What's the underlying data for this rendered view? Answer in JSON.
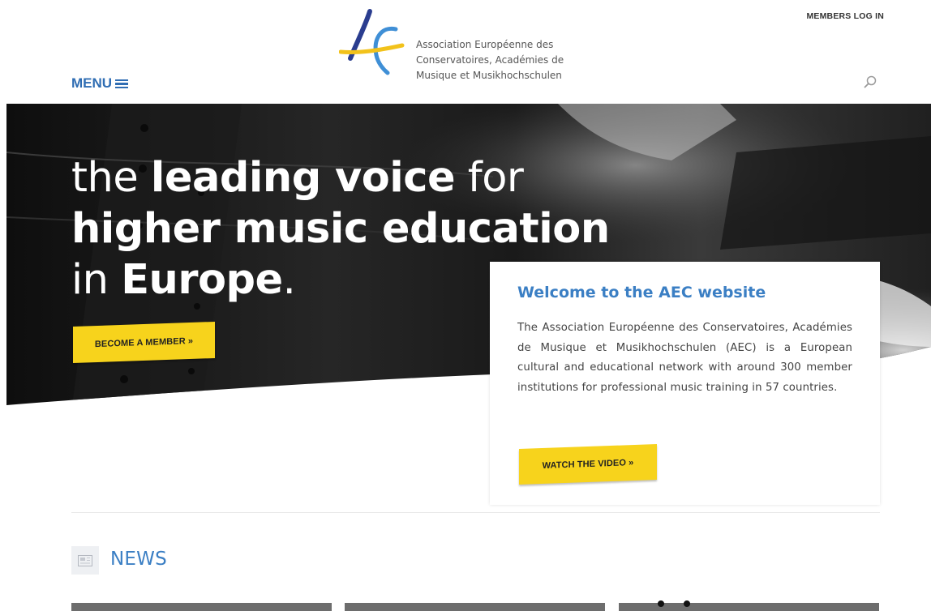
{
  "header": {
    "members_login": "MEMBERS LOG IN",
    "menu_label": "MENU",
    "logo_text": [
      "Association Européenne des",
      "Conservatoires, Académies de",
      "Musique et Musikhochschulen"
    ]
  },
  "hero": {
    "headline": {
      "line1_a": "the ",
      "line1_b": "leading voice",
      "line1_c": " for",
      "line2": "higher music education",
      "line3_a": "in ",
      "line3_b": "Europe",
      "line3_c": "."
    },
    "become_member_label": "BECOME A MEMBER »"
  },
  "welcome": {
    "title": "Welcome to the AEC website",
    "body": "The Association Européenne des Conservatoires, Académies de Musique et Musikhochschulen (AEC) is a European cultural and educational network with around 300 member institutions for professional music training in 57 countries.",
    "video_label": "WATCH THE VIDEO »"
  },
  "news": {
    "title": "NEWS"
  },
  "colors": {
    "accent_blue": "#3b7fc4",
    "button_yellow": "#f7d31c"
  },
  "icons": [
    "menu-icon",
    "search-icon",
    "news-icon",
    "aec-logo-icon"
  ]
}
